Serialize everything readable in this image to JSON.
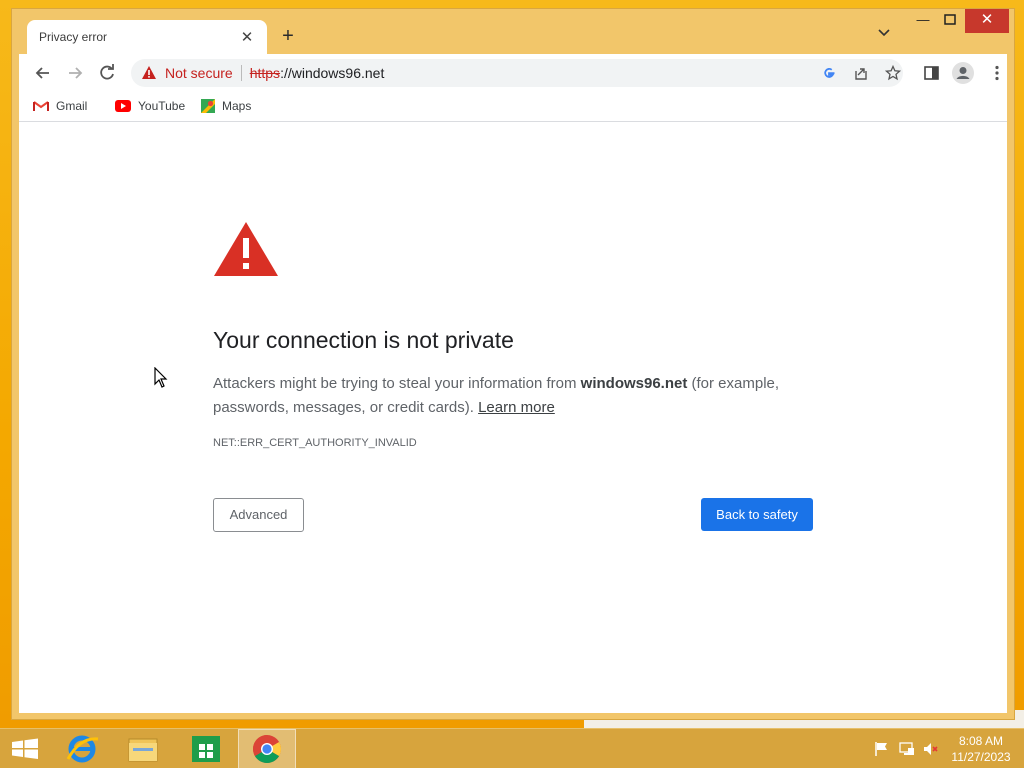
{
  "browser": {
    "tab": {
      "title": "Privacy error"
    },
    "omnibox": {
      "security_label": "Not secure",
      "url_scheme": "https",
      "url_rest": "://windows96.net"
    },
    "bookmarks": [
      {
        "label": "Gmail",
        "icon": "gmail-icon"
      },
      {
        "label": "YouTube",
        "icon": "youtube-icon"
      },
      {
        "label": "Maps",
        "icon": "maps-icon"
      }
    ]
  },
  "page": {
    "heading": "Your connection is not private",
    "desc_part1": "Attackers might be trying to steal your information from ",
    "desc_domain": "windows96.net",
    "desc_part2": " (for example, passwords, messages, or credit cards). ",
    "learn_more": "Learn more",
    "error_code": "NET::ERR_CERT_AUTHORITY_INVALID",
    "advanced_label": "Advanced",
    "back_label": "Back to safety"
  },
  "taskbar": {
    "apps": [
      "start-button",
      "internet-explorer",
      "file-explorer",
      "store",
      "chrome"
    ],
    "time": "8:08 AM",
    "date": "11/27/2023"
  },
  "colors": {
    "accent_blue": "#1a73e8",
    "danger_red": "#d93025",
    "window_frame": "#f2c66a",
    "taskbar": "#d7a43d"
  }
}
